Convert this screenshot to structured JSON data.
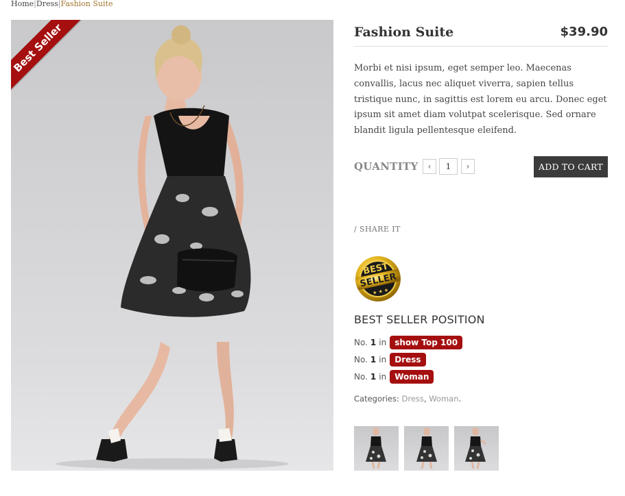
{
  "breadcrumb": {
    "home": "Home",
    "sep1": "|",
    "category": "Dress",
    "sep2": "|",
    "current": "Fashion Suite"
  },
  "image": {
    "ribbon": "Best Seller"
  },
  "product": {
    "title": "Fashion Suite",
    "price": "$39.90",
    "description": "Morbi et nisi ipsum, eget semper leo. Maecenas convallis, lacus nec aliquet viverra, sapien tellus tristique nunc, in sagittis est lorem eu arcu. Donec eget ipsum sit amet diam volutpat scelerisque. Sed ornare blandit ligula pellentesque eleifend."
  },
  "quantity": {
    "label": "QUANTITY",
    "decrease_icon": "‹",
    "increase_icon": "›",
    "value": "1",
    "add_to_cart": "ADD TO CART"
  },
  "share": {
    "label": "/ SHARE IT"
  },
  "badge": {
    "line1": "BEST",
    "line2": "SELLER",
    "stars": "★ ★ ★"
  },
  "best_seller": {
    "heading": "BEST SELLER POSITION",
    "ranks": [
      {
        "prefix": "No.",
        "number": "1",
        "in": "in",
        "tag": "show Top 100"
      },
      {
        "prefix": "No.",
        "number": "1",
        "in": "in",
        "tag": "Dress"
      },
      {
        "prefix": "No.",
        "number": "1",
        "in": "in",
        "tag": "Woman"
      }
    ]
  },
  "categories": {
    "label": "Categories:",
    "items": [
      "Dress",
      "Woman"
    ],
    "sep": ",",
    "end": "."
  },
  "colors": {
    "ribbon": "#a50f0f",
    "rank_tag": "#a50f0f",
    "cart_button": "#3b3b3b",
    "breadcrumb_current": "#a0742c"
  }
}
